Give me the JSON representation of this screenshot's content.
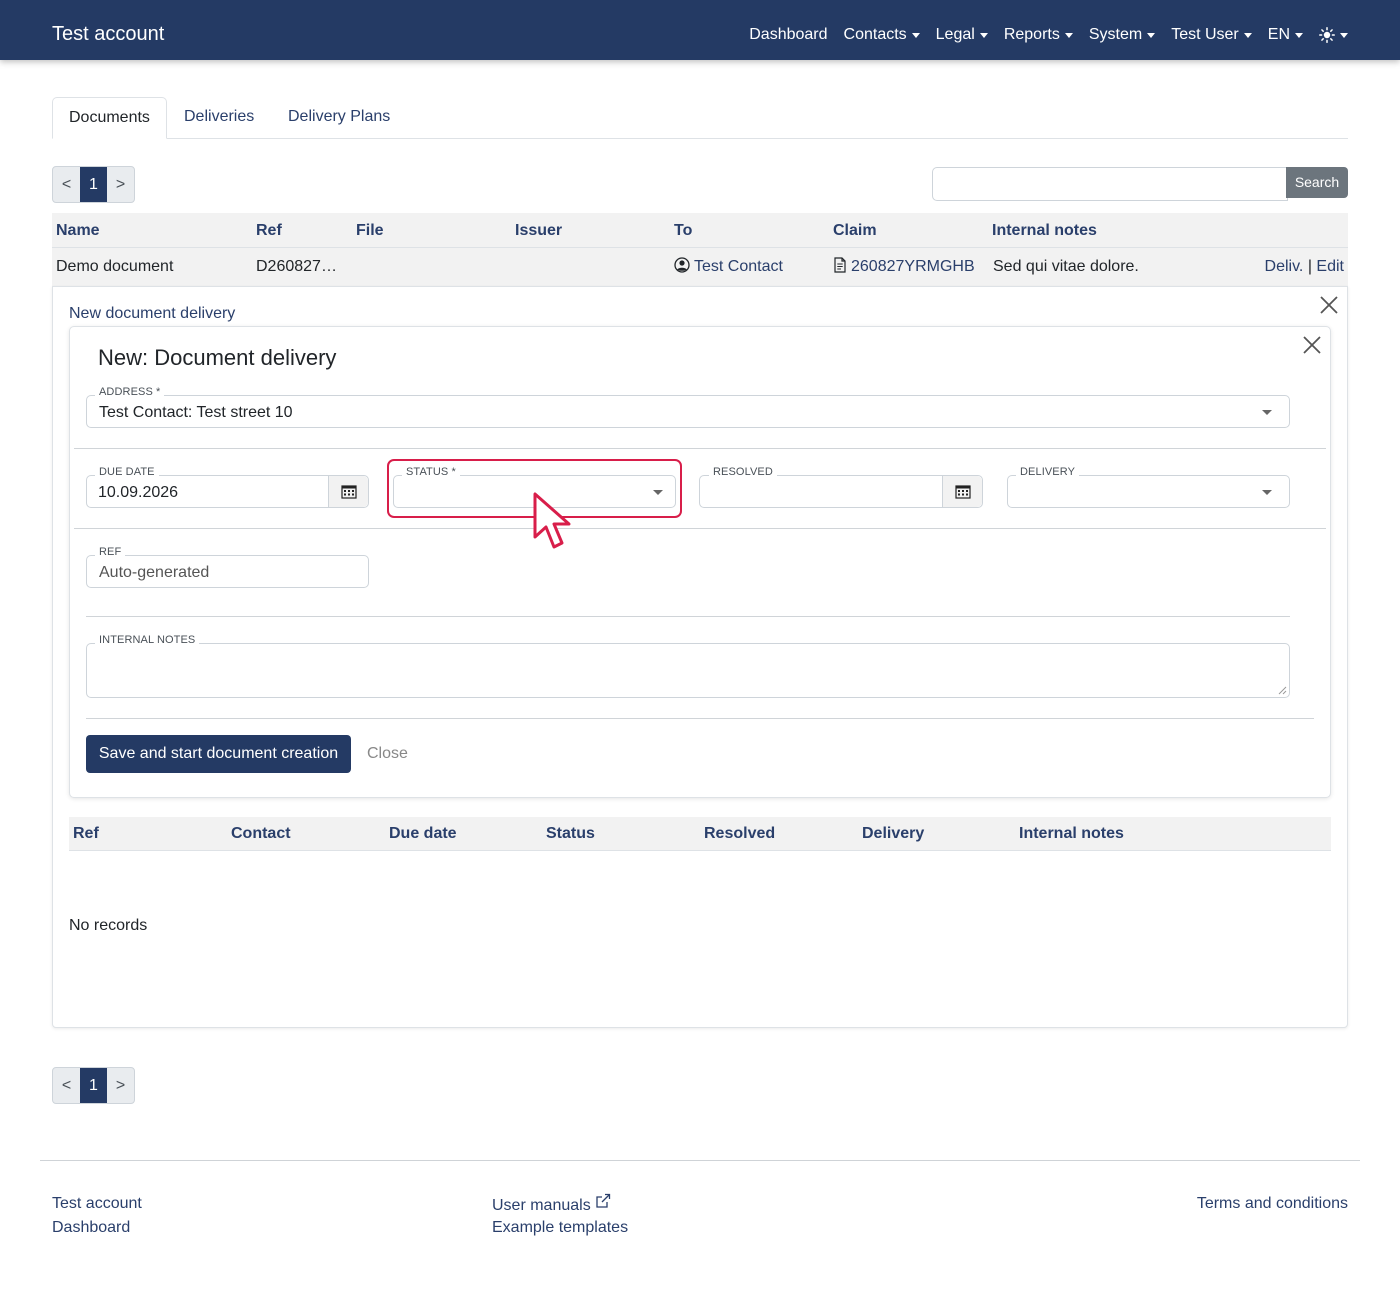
{
  "app": {
    "title": "Test account"
  },
  "nav": {
    "items": [
      {
        "label": "Dashboard",
        "dropdown": false
      },
      {
        "label": "Contacts",
        "dropdown": true
      },
      {
        "label": "Legal",
        "dropdown": true
      },
      {
        "label": "Reports",
        "dropdown": true
      },
      {
        "label": "System",
        "dropdown": true
      },
      {
        "label": "Test User",
        "dropdown": true
      },
      {
        "label": "EN",
        "dropdown": true
      }
    ],
    "theme_icon": "sun-icon"
  },
  "tabs": [
    {
      "label": "Documents",
      "active": true
    },
    {
      "label": "Deliveries",
      "active": false
    },
    {
      "label": "Delivery Plans",
      "active": false
    }
  ],
  "pagination": {
    "prev": "<",
    "current": "1",
    "next": ">"
  },
  "search": {
    "button": "Search",
    "value": ""
  },
  "documents_table": {
    "columns": [
      "Name",
      "Ref",
      "File",
      "Issuer",
      "To",
      "Claim",
      "Internal notes"
    ],
    "rows": [
      {
        "name": "Demo document",
        "ref": "D260827…",
        "file": "",
        "issuer": "",
        "to": "Test Contact",
        "claim": "260827YRMGHB",
        "notes": "Sed qui vitae dolore.",
        "action_deliv": "Deliv.",
        "action_sep": "|",
        "action_edit": "Edit"
      }
    ]
  },
  "panel": {
    "link": "New document delivery",
    "form": {
      "title": "New: Document delivery",
      "address_label": "ADDRESS *",
      "address_value": "Test Contact: Test street 10",
      "due_label": "DUE DATE",
      "due_value": "10.09.2026",
      "status_label": "STATUS *",
      "status_value": "",
      "resolved_label": "RESOLVED",
      "resolved_value": "",
      "delivery_label": "DELIVERY",
      "delivery_value": "",
      "ref_label": "REF",
      "ref_value": "Auto-generated",
      "notes_label": "INTERNAL NOTES",
      "notes_value": "",
      "save_button": "Save and start document creation",
      "close_button": "Close"
    },
    "deliveries_table": {
      "columns": [
        "Ref",
        "Contact",
        "Due date",
        "Status",
        "Resolved",
        "Delivery",
        "Internal notes"
      ],
      "empty": "No records"
    }
  },
  "footer": {
    "col1": [
      "Test account",
      "Dashboard"
    ],
    "col2": [
      "User manuals",
      "Example templates"
    ],
    "col3": [
      "Terms and conditions"
    ]
  },
  "colors": {
    "navbar": "#243a64",
    "primary": "#243a64",
    "highlight": "#d81e4a"
  }
}
